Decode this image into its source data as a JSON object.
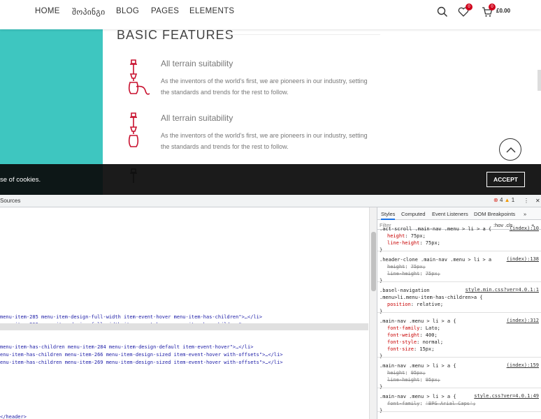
{
  "nav": {
    "items": [
      "HOME",
      "შოპინგი",
      "BLOG",
      "PAGES",
      "ELEMENTS"
    ],
    "wishlist_count": "0",
    "cart_count": "0",
    "cart_total": "£0.00"
  },
  "features": {
    "title": "BASIC FEATURES",
    "items": [
      {
        "heading": "All terrain suitability",
        "text": "As the inventors of the world's first, we are pioneers in our industry, setting the standards and trends for the rest to follow."
      },
      {
        "heading": "All terrain suitability",
        "text": "As the inventors of the world's first, we are pioneers in our industry, setting the standards and trends for the rest to follow."
      }
    ]
  },
  "cookie": {
    "text": "se of cookies.",
    "accept_label": "ACCEPT"
  },
  "devtools": {
    "tab_sources": "Sources",
    "errors": "4",
    "warnings": "1",
    "element_lines": [
      "menu-item-285 menu-item-design-full-width item-event-hover menu-item-has-children\">…</li>",
      "menu-item-293 menu-item-design-full-width item-event-hover menu-item-has-children\">",
      "menu-item-has-children menu-item-284 menu-item-design-default item-event-hover\">…</li>",
      "enu-item-has-children menu-item-266 menu-item-design-sized item-event-hover with-offsets\">…</li>",
      "enu-item-has-children menu-item-269 menu-item-design-sized item-event-hover with-offsets\">…</li>",
      "</header>"
    ],
    "style_tabs": [
      "Styles",
      "Computed",
      "Event Listeners",
      "DOM Breakpoints"
    ],
    "filter_placeholder": "Filter",
    "hov_cls": ":hov .cls",
    "rules": [
      {
        "selector": ".act-scroll .main-nav .menu > li > a {",
        "source": "(index):10",
        "props": [
          {
            "p": "height",
            "v": "75px;",
            "strike": false
          },
          {
            "p": "line-height",
            "v": "75px;",
            "strike": false
          }
        ]
      },
      {
        "selector": ".header-clone .main-nav .menu > li > a",
        "source": "(index):138",
        "props": [
          {
            "p": "height",
            "v": "75px;",
            "strike": true
          },
          {
            "p": "line-height",
            "v": "75px;",
            "strike": true
          }
        ]
      },
      {
        "selector": ".basel-navigation\n.menu>li.menu-item-has-children>a {",
        "source": "style.min.css?ver=4.0.1:1",
        "props": [
          {
            "p": "position",
            "v": "relative;",
            "strike": false
          }
        ]
      },
      {
        "selector": ".main-nav .menu > li > a {",
        "source": "(index):312",
        "props": [
          {
            "p": "font-family",
            "v": "Lato;",
            "strike": false
          },
          {
            "p": "font-weight",
            "v": "400;",
            "strike": false
          },
          {
            "p": "font-style",
            "v": "normal;",
            "strike": false
          },
          {
            "p": "font-size",
            "v": "15px;",
            "strike": false
          }
        ]
      },
      {
        "selector": ".main-nav .menu > li > a {",
        "source": "(index):159",
        "props": [
          {
            "p": "height",
            "v": "95px;",
            "strike": true
          },
          {
            "p": "line-height",
            "v": "95px;",
            "strike": true
          }
        ]
      },
      {
        "selector": ".main-nav .menu > li > a {",
        "source": "style.css?ver=4.0.1:49",
        "props": [
          {
            "p": "font-family",
            "v": "'BPG Arial Caps';",
            "strike": true
          }
        ]
      }
    ]
  }
}
